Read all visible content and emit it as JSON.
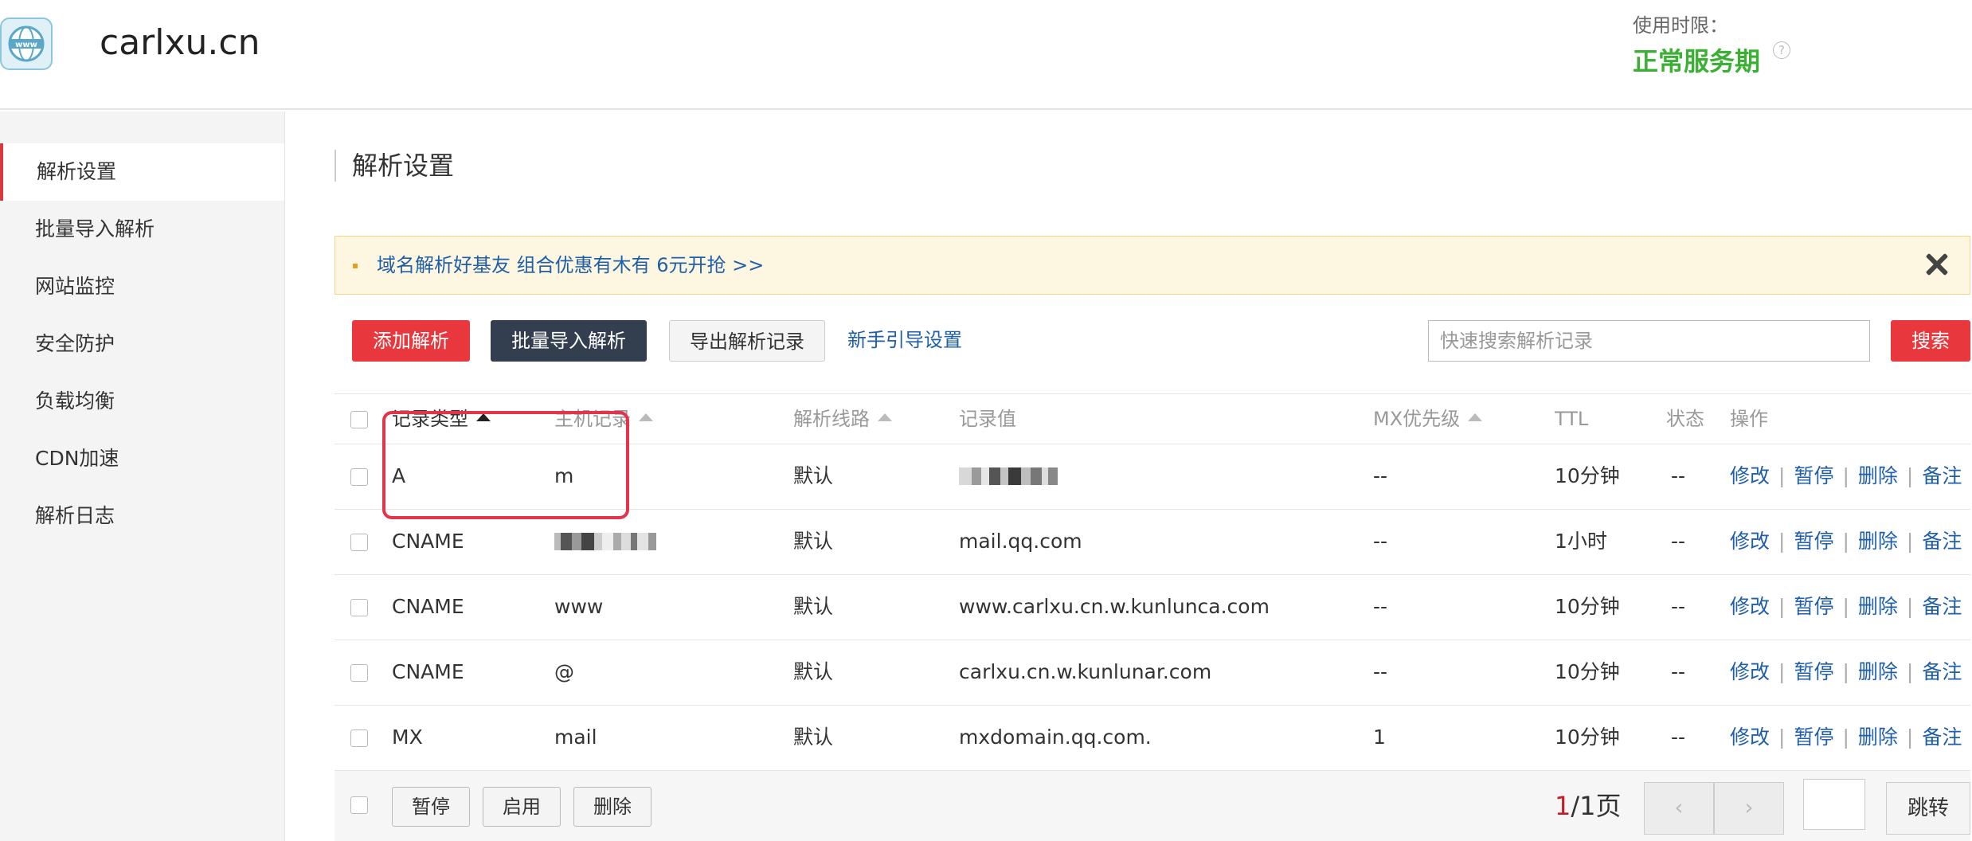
{
  "header": {
    "domain": "carlxu.cn",
    "service_label": "使用时限：",
    "service_status": "正常服务期",
    "help_glyph": "?"
  },
  "sidebar": {
    "items": [
      {
        "label": "解析设置",
        "active": true
      },
      {
        "label": "批量导入解析"
      },
      {
        "label": "网站监控"
      },
      {
        "label": "安全防护"
      },
      {
        "label": "负载均衡"
      },
      {
        "label": "CDN加速"
      },
      {
        "label": "解析日志"
      }
    ]
  },
  "main": {
    "title": "解析设置",
    "notice": "域名解析好基友 组合优惠有木有 6元开抢 >>"
  },
  "toolbar": {
    "add_label": "添加解析",
    "batch_import_label": "批量导入解析",
    "export_label": "导出解析记录",
    "guide_link": "新手引导设置",
    "search_placeholder": "快速搜索解析记录",
    "search_label": "搜索"
  },
  "table": {
    "headers": {
      "type": "记录类型",
      "host": "主机记录",
      "line": "解析线路",
      "value": "记录值",
      "mx": "MX优先级",
      "ttl": "TTL",
      "status": "状态",
      "ops": "操作"
    },
    "op_labels": {
      "edit": "修改",
      "pause": "暂停",
      "delete": "删除",
      "note": "备注",
      "sep": "|"
    },
    "rows": [
      {
        "type": "A",
        "host": "m",
        "line": "默认",
        "value": "",
        "mx": "--",
        "ttl": "10分钟",
        "status": "--"
      },
      {
        "type": "CNAME",
        "host": "",
        "line": "默认",
        "value": "mail.qq.com",
        "mx": "--",
        "ttl": "1小时",
        "status": "--"
      },
      {
        "type": "CNAME",
        "host": "www",
        "line": "默认",
        "value": "www.carlxu.cn.w.kunlunca.com",
        "mx": "--",
        "ttl": "10分钟",
        "status": "--"
      },
      {
        "type": "CNAME",
        "host": "@",
        "line": "默认",
        "value": "carlxu.cn.w.kunlunar.com",
        "mx": "--",
        "ttl": "10分钟",
        "status": "--"
      },
      {
        "type": "MX",
        "host": "mail",
        "line": "默认",
        "value": "mxdomain.qq.com.",
        "mx": "1",
        "ttl": "10分钟",
        "status": "--"
      }
    ]
  },
  "footer": {
    "pause_label": "暂停",
    "enable_label": "启用",
    "delete_label": "删除",
    "current_page": "1",
    "total_pages": "/1页",
    "prev_glyph": "‹",
    "next_glyph": "›",
    "jump_label": "跳转"
  },
  "colors": {
    "accent_red": "#e8383d",
    "dark_button": "#333f4f",
    "link_blue": "#1f5ea8",
    "status_green": "#3cb034",
    "highlight": "#e2344c"
  }
}
